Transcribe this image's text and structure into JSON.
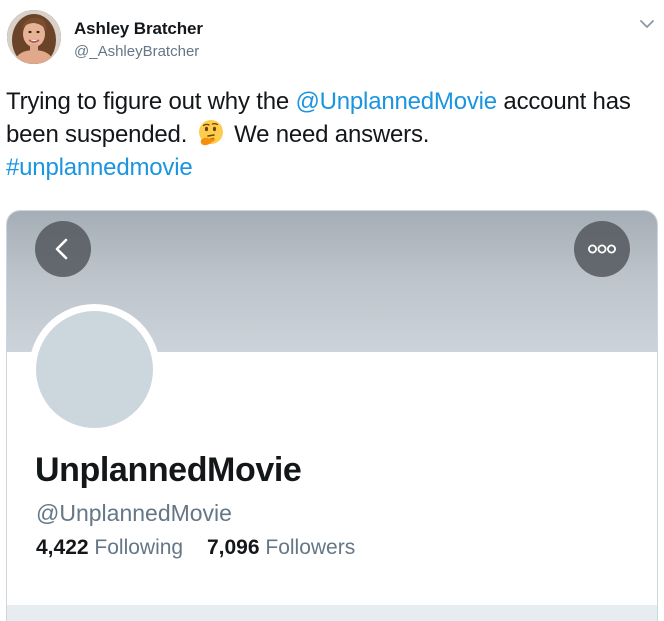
{
  "tweet": {
    "author": {
      "name": "Ashley Bratcher",
      "handle": "@_AshleyBratcher"
    },
    "text": {
      "part1": "Trying to figure out why the ",
      "mention": "@UnplannedMovie",
      "part2": " account has been suspended. ",
      "emoji": "thinking-face",
      "part3": " We need answers.",
      "hashtag": "#unplannedmovie"
    }
  },
  "profile_card": {
    "name": "UnplannedMovie",
    "handle": "@UnplannedMovie",
    "following_count": "4,422",
    "following_label": "Following",
    "followers_count": "7,096",
    "followers_label": "Followers"
  },
  "icons": {
    "tweet_menu": "chevron-down-icon",
    "back": "chevron-left-icon",
    "more": "more-dots-icon"
  },
  "colors": {
    "link": "#1b95e0",
    "text": "#14171a",
    "secondary": "#657786",
    "banner_top": "#a5adb6",
    "banner_bottom": "#ccd3da",
    "avatar_placeholder": "#ccd6dd"
  }
}
